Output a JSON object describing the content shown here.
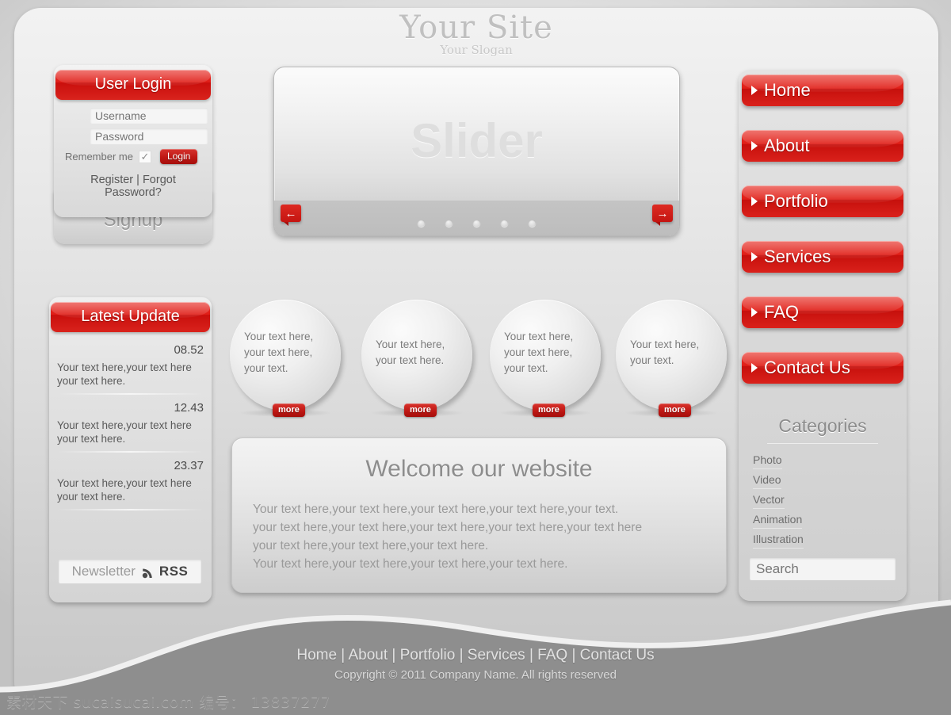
{
  "header": {
    "title": "Your Site",
    "slogan": "Your Slogan"
  },
  "login": {
    "panel_title": "User Login",
    "username_placeholder": "Username",
    "password_placeholder": "Password",
    "remember_label": "Remember me",
    "checkbox_glyph": "✓",
    "login_button": "Login",
    "links": "Register | Forgot Password?",
    "signup_tab": "Signup"
  },
  "slider": {
    "word": "Slider",
    "prev_icon": "←",
    "next_icon": "→",
    "dots": 5
  },
  "nav": {
    "items": [
      {
        "label": "Home"
      },
      {
        "label": "About"
      },
      {
        "label": "Portfolio"
      },
      {
        "label": "Services"
      },
      {
        "label": "FAQ"
      },
      {
        "label": "Contact Us"
      }
    ]
  },
  "categories": {
    "title": "Categories",
    "items": [
      "Photo",
      "Video",
      "Vector",
      "Animation",
      "Illustration"
    ],
    "search_placeholder": "Search"
  },
  "latest": {
    "panel_title": "Latest Update",
    "entries": [
      {
        "time": "08.52",
        "text": "Your text here,your text here your text here."
      },
      {
        "time": "12.43",
        "text": "Your text here,your text here your text here."
      },
      {
        "time": "23.37",
        "text": "Your text here,your text here your text here."
      }
    ],
    "newsletter_label": "Newsletter",
    "rss_label": "RSS"
  },
  "circles": [
    {
      "text": "Your text here, your text here, your text.",
      "more": "more"
    },
    {
      "text": "Your text here, your text here.",
      "more": "more"
    },
    {
      "text": "Your text here, your text here, your text.",
      "more": "more"
    },
    {
      "text": "Your text here, your text.",
      "more": "more"
    }
  ],
  "welcome": {
    "title": "Welcome our website",
    "lines": [
      "Your text here,your text here,your text here,your text here,your text.",
      "your text here,your text here,your text here,your text here,your text here",
      "your text here,your text here,your text here.",
      "Your text here,your text here,your text here,your text here."
    ]
  },
  "footer": {
    "nav": "Home | About | Portfolio | Services | FAQ | Contact Us",
    "copyright": "Copyright © 2011 Company Name. All rights reserved"
  },
  "watermark": "素材天下 sucaisucai.com  编号： 13837277",
  "colors": {
    "accent_red": "#d9211b",
    "accent_red_dark": "#a40f0c",
    "page_bg": "#e6e6e6",
    "footer_wave": "#8e8e8e",
    "text_gray": "#8d8d8d"
  }
}
